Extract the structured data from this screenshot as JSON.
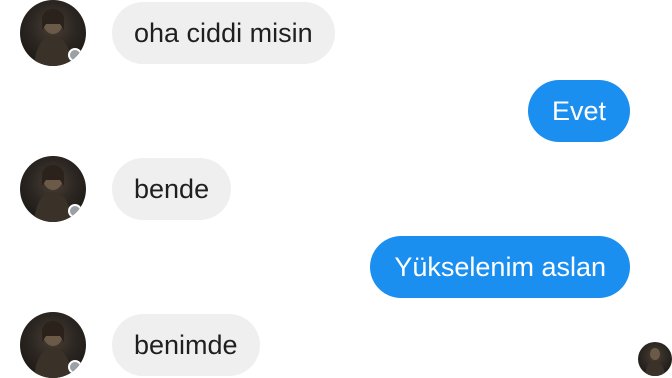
{
  "messages": [
    {
      "direction": "incoming",
      "text": "oha ciddi misin",
      "avatar": "contact-avatar"
    },
    {
      "direction": "outgoing",
      "text": "Evet"
    },
    {
      "direction": "incoming",
      "text": "bende",
      "avatar": "contact-avatar"
    },
    {
      "direction": "outgoing",
      "text": "Yükselenim aslan"
    },
    {
      "direction": "incoming",
      "text": "benimde",
      "avatar": "contact-avatar"
    }
  ],
  "seen_indicator": {
    "icon": "seen-avatar-icon"
  },
  "colors": {
    "incoming_bubble": "#efefef",
    "outgoing_bubble": "#1b8ff0",
    "outgoing_text": "#ffffff",
    "incoming_text": "#1f1f1f",
    "background": "#ffffff"
  }
}
